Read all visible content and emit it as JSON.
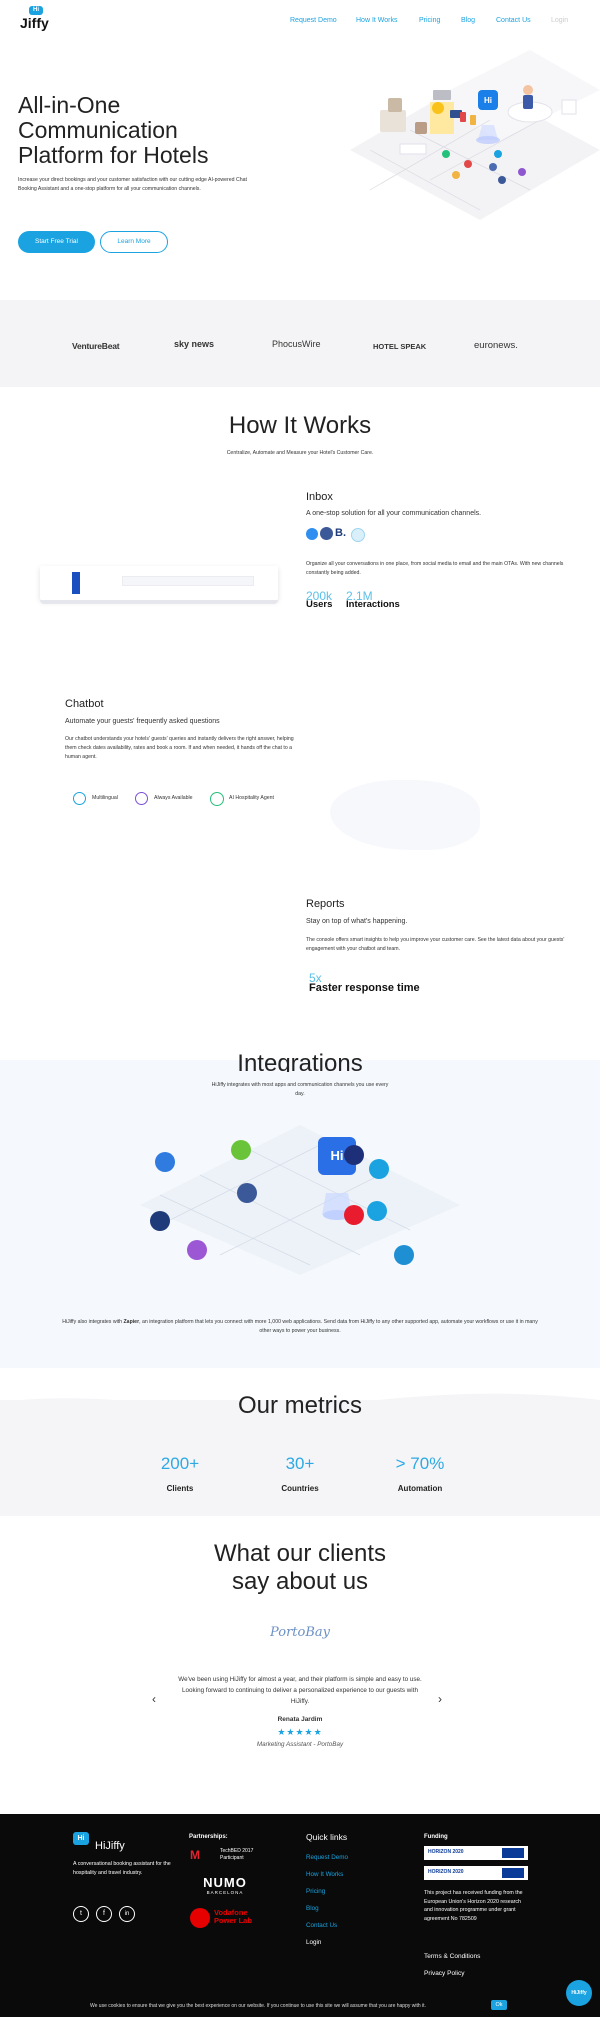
{
  "nav": {
    "logo_badge": "Hi",
    "logo_text": "Jiffy",
    "items": [
      "Request Demo",
      "How It Works",
      "Pricing",
      "Blog",
      "Contact Us",
      "Login"
    ]
  },
  "hero": {
    "title_line1": "All-in-One",
    "title_line2": "Communication",
    "title_line3": "Platform for Hotels",
    "description": "Increase your direct bookings and your customer satisfaction with our cutting edge AI-powered Chat Booking Assistant and a one-stop platform for all your communication channels.",
    "primary_button": "Start Free Trial",
    "secondary_button": "Learn More",
    "illustration_badge": "Hi"
  },
  "press": [
    "VentureBeat",
    "sky news",
    "PhocusWire",
    "HOTEL SPEAK",
    "euronews."
  ],
  "how": {
    "title": "How It Works",
    "subtitle": "Centralize, Automate and Measure your Hotel's Customer Care.",
    "inbox": {
      "title": "Inbox",
      "subtitle": "A one-stop solution for all your communication channels.",
      "body": "Organize all your conversations in one place, from social media to email and the main OTAs. With new channels constantly being added.",
      "stat1_num": "200k",
      "stat1_label": "Users",
      "stat2_num": "2.1M",
      "stat2_label": "Interactions"
    },
    "chatbot": {
      "title": "Chatbot",
      "subtitle": "Automate your guests' frequently asked questions",
      "body": "Our chatbot understands your hotels' guests' queries and instantly delivers the right answer, helping them check dates availability, rates and book a room. If and when needed, it hands off the chat to a human agent.",
      "features": [
        "Multilingual",
        "Always Available",
        "AI Hospitality Agent"
      ]
    },
    "reports": {
      "title": "Reports",
      "subtitle": "Stay on top of what's happening.",
      "body": "The console offers smart insights to help you improve your customer care. See the latest data about your guests' engagement with your chatbot and team.",
      "stat_num": "5x",
      "stat_label": "Faster response time"
    }
  },
  "integrations": {
    "title": "Integrations",
    "subtitle": "HiJiffy integrates with most apps and communication channels you use every day.",
    "badge": "Hi",
    "zapier_pre": "HiJiffy also integrates with ",
    "zapier_name": "Zapier",
    "zapier_post": ", an integration platform that lets you connect with more 1,000 web applications. Send data from HiJiffy to any other supported app, automate your workflows or use it in many other ways to power your business."
  },
  "metrics": {
    "title": "Our metrics",
    "items": [
      {
        "value": "200+",
        "label": "Clients"
      },
      {
        "value": "30+",
        "label": "Countries"
      },
      {
        "value": "> 70%",
        "label": "Automation"
      }
    ]
  },
  "testimonials": {
    "title_line1": "What our clients",
    "title_line2": "say about us",
    "logo": "PortoBay",
    "quote": "We've been using HiJiffy for almost a year, and their platform is simple and easy to use. Looking forward to continuing to deliver a personalized experience to our guests with HiJiffy.",
    "author": "Renata Jardim",
    "stars": "★★★★★",
    "role": "Marketing Assistant - PortoBay",
    "prev": "‹",
    "next": "›"
  },
  "footer": {
    "brand_badge": "Hi",
    "brand": "HiJiffy",
    "tagline": "A conversational booking assistant for the hospitality and travel industry.",
    "social_icons": [
      "t",
      "f",
      "in"
    ],
    "partnerships_title": "Partnerships:",
    "partner1_line1": "TechBED 2017",
    "partner1_line2": "Participant",
    "partner2_name": "NUMO",
    "partner2_city": "BARCELONA",
    "partner3_line1": "Vodafone",
    "partner3_line2": "Power Lab",
    "quick_title": "Quick links",
    "quick_links": [
      "Request Demo",
      "How It Works",
      "Pricing",
      "Blog",
      "Contact Us",
      "Login"
    ],
    "funding_title": "Funding",
    "funding_logo1": "HORIZON 2020",
    "funding_logo2": "HORIZON 2020",
    "funding_text": "This project has received funding from the European Union's Horizon 2020 research and innovation programme under grant agreement No 782509",
    "terms": "Terms & Conditions",
    "privacy": "Privacy Policy"
  },
  "cookie": {
    "text": "We use cookies to ensure that we give you the best experience on our website. If you continue to use this site we will assume that you are happy with it.",
    "ok": "Ok"
  },
  "chat_widget": {
    "label": "HiJiffy"
  },
  "colors": {
    "accent": "#1aa3e0",
    "footer_bg": "#0a0a0a",
    "press_bg": "#f4f4f6",
    "integrations_bg": "#f5f9fd"
  }
}
